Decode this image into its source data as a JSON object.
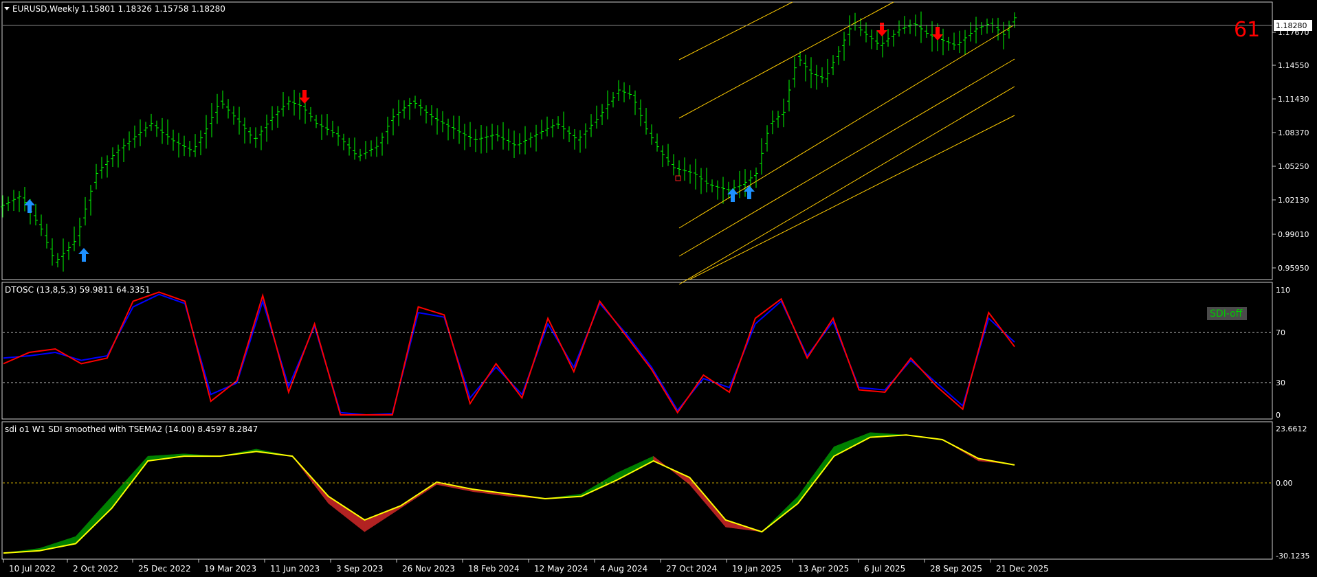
{
  "main": {
    "symbol": "EURUSD,Weekly",
    "ohlc": "1.15801 1.18326 1.15758 1.18280",
    "price_label": "1.18280",
    "counter": "61",
    "y_ticks": [
      "1.17670",
      "1.14550",
      "1.11430",
      "1.08370",
      "1.05250",
      "1.02130",
      "0.99010",
      "0.95950"
    ]
  },
  "dtosc": {
    "title": "DTOSC (13,8,5,3) 59.9811 64.3351",
    "y_ticks": [
      "110",
      "70",
      "30",
      "0"
    ],
    "badge": "SDI-off"
  },
  "sdi": {
    "title": "sdi o1 W1 SDI smoothed with TSEMA2 (14.00) 8.4597 8.2847",
    "y_ticks": [
      "23.6612",
      "0.00",
      "-30.1235"
    ]
  },
  "x_labels": [
    "10 Jul 2022",
    "2 Oct 2022",
    "25 Dec 2022",
    "19 Mar 2023",
    "11 Jun 2023",
    "3 Sep 2023",
    "26 Nov 2023",
    "18 Feb 2024",
    "12 May 2024",
    "4 Aug 2024",
    "27 Oct 2024",
    "19 Jan 2025",
    "13 Apr 2025",
    "6 Jul 2025",
    "28 Sep 2025",
    "21 Dec 2025"
  ],
  "colors": {
    "background": "#000000",
    "bars": "#00ff00",
    "channel": "#ffcc00",
    "arrow_up": "#1e90ff",
    "arrow_down": "#ff0000",
    "dtosc_fast": "#ff0000",
    "dtosc_slow": "#0000ff",
    "sdi_line": "#ffff00",
    "sdi_fill_up": "#008000",
    "sdi_fill_down": "#b22222",
    "grid_level": "#c0c0c0",
    "badge_bg": "#4a4a4a",
    "badge_text": "#00cc00"
  },
  "chart_data": [
    {
      "type": "line",
      "title": "EURUSD,Weekly",
      "series": [
        {
          "name": "EURUSD",
          "x": [
            "10 Jul 2022",
            "2 Oct 2022",
            "25 Dec 2022",
            "19 Mar 2023",
            "11 Jun 2023",
            "3 Sep 2023",
            "26 Nov 2023",
            "18 Feb 2024",
            "12 May 2024",
            "4 Aug 2024",
            "27 Oct 2024",
            "19 Jan 2025",
            "13 Apr 2025",
            "6 Jul 2025",
            "28 Sep 2025",
            "21 Dec 2025"
          ],
          "values": [
            1.015,
            0.98,
            1.07,
            1.085,
            1.095,
            1.07,
            1.09,
            1.08,
            1.075,
            1.1,
            1.055,
            1.035,
            1.14,
            1.17,
            1.165,
            1.1828
          ]
        }
      ],
      "ylim": [
        0.9445,
        1.1935
      ],
      "y_ticks": [
        1.1767,
        1.1455,
        1.1143,
        1.0837,
        1.0525,
        1.0213,
        0.9901,
        0.9595
      ]
    },
    {
      "type": "line",
      "title": "DTOSC (13,8,5,3) 59.9811 64.3351",
      "series": [
        {
          "name": "",
          "values": [
            45,
            55,
            58,
            45,
            50,
            100,
            108,
            100,
            12,
            30,
            105,
            20,
            80,
            0,
            0,
            0,
            95,
            88,
            10,
            45,
            15,
            85,
            38,
            100,
            70,
            40,
            2,
            35,
            20,
            85,
            102,
            50,
            85,
            22,
            20,
            50,
            25,
            5,
            90,
            60
          ]
        },
        {
          "name": "",
          "values": [
            50,
            52,
            55,
            48,
            52,
            95,
            106,
            98,
            18,
            28,
            100,
            25,
            78,
            2,
            0,
            1,
            90,
            86,
            15,
            42,
            18,
            80,
            42,
            98,
            72,
            42,
            4,
            32,
            24,
            80,
            100,
            52,
            82,
            24,
            22,
            48,
            28,
            8,
            85,
            64
          ]
        }
      ],
      "ylim": [
        0,
        110
      ],
      "levels": [
        70,
        30
      ]
    },
    {
      "type": "area",
      "title": "sdi o1 W1 SDI smoothed with TSEMA2 (14.00) 8.4597 8.2847",
      "series": [
        {
          "name": "",
          "values": [
            -29,
            -27,
            -22,
            -5,
            12,
            13,
            12,
            15,
            12,
            -8,
            -20,
            -10,
            0,
            -3,
            -5,
            -6,
            -4,
            5,
            12,
            0,
            -18,
            -20,
            -5,
            16,
            22,
            21,
            19,
            10,
            8.46
          ]
        },
        {
          "name": "",
          "values": [
            -29,
            -28,
            -25,
            -10,
            10,
            12,
            12,
            14,
            12,
            -5,
            -15,
            -9,
            1,
            -2,
            -4,
            -6,
            -5,
            2,
            10,
            3,
            -15,
            -20,
            -8,
            12,
            20,
            21,
            19,
            11,
            8.28
          ]
        }
      ],
      "ylim": [
        -30.1235,
        23.6612
      ]
    }
  ]
}
